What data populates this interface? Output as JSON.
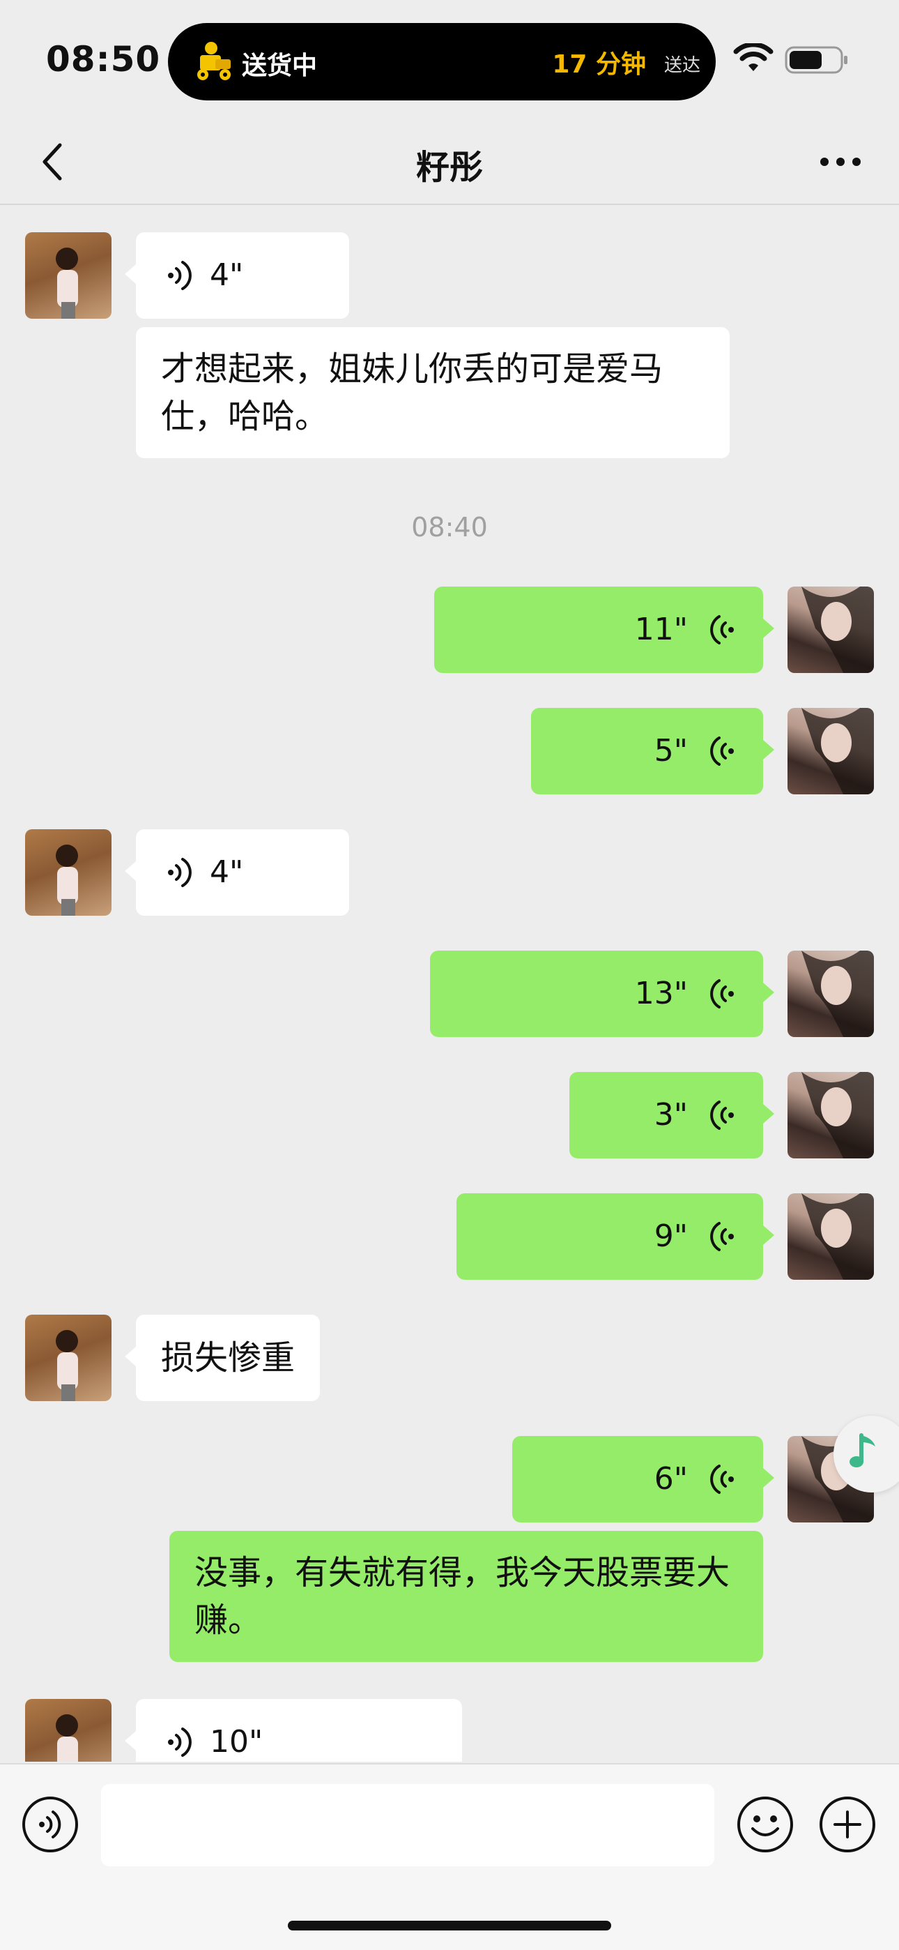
{
  "status_bar": {
    "time": "08:50",
    "island": {
      "status": "送货中",
      "eta": "17 分钟",
      "eta_suffix": "送达",
      "icon": "delivery-rider-icon"
    },
    "icons": [
      "wifi-icon",
      "battery-icon"
    ]
  },
  "nav": {
    "title": "籽彤",
    "back_icon": "chevron-left-icon",
    "more_icon": "more-dots-icon"
  },
  "messages": [
    {
      "side": "in",
      "kind": "voice",
      "duration": "4\""
    },
    {
      "side": "in",
      "kind": "text",
      "text": "才想起来，姐妹儿你丢的可是爱马仕，哈哈。"
    },
    {
      "kind": "time",
      "text": "08:40"
    },
    {
      "side": "out",
      "kind": "voice",
      "duration": "11\""
    },
    {
      "side": "out",
      "kind": "voice",
      "duration": "5\""
    },
    {
      "side": "in",
      "kind": "voice",
      "duration": "4\""
    },
    {
      "side": "out",
      "kind": "voice",
      "duration": "13\""
    },
    {
      "side": "out",
      "kind": "voice",
      "duration": "3\""
    },
    {
      "side": "out",
      "kind": "voice",
      "duration": "9\""
    },
    {
      "side": "in",
      "kind": "text",
      "text": "损失惨重"
    },
    {
      "side": "out",
      "kind": "voice",
      "duration": "6\""
    },
    {
      "side": "out",
      "kind": "text",
      "text": "没事，有失就有得，我今天股票要大赚。"
    },
    {
      "side": "in",
      "kind": "voice",
      "duration": "10\""
    }
  ],
  "floating": {
    "icon": "music-note-icon"
  },
  "input_bar": {
    "voice_icon": "voice-toggle-icon",
    "placeholder": "",
    "emoji_icon": "emoji-icon",
    "plus_icon": "plus-icon"
  },
  "colors": {
    "background": "#ededed",
    "bubble_out": "#95ec69",
    "bubble_in": "#ffffff",
    "eta": "#f5b800"
  }
}
